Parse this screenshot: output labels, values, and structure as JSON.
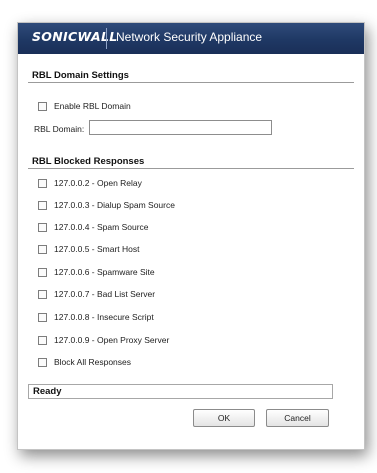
{
  "header": {
    "brand": "SONICWALL",
    "title": "Network Security Appliance"
  },
  "rbl_domain_settings": {
    "title": "RBL Domain Settings",
    "enable_label": "Enable RBL Domain",
    "domain_label": "RBL Domain:",
    "domain_value": ""
  },
  "rbl_blocked_responses": {
    "title": "RBL Blocked Responses",
    "items": [
      {
        "label": "127.0.0.2 - Open Relay"
      },
      {
        "label": "127.0.0.3 - Dialup Spam Source"
      },
      {
        "label": "127.0.0.4 - Spam Source"
      },
      {
        "label": "127.0.0.5 - Smart Host"
      },
      {
        "label": "127.0.0.6 - Spamware Site"
      },
      {
        "label": "127.0.0.7 - Bad List Server"
      },
      {
        "label": "127.0.0.8 - Insecure Script"
      },
      {
        "label": "127.0.0.9 - Open Proxy Server"
      },
      {
        "label": "Block All Responses"
      }
    ]
  },
  "status": {
    "text": "Ready"
  },
  "buttons": {
    "ok": "OK",
    "cancel": "Cancel"
  },
  "colors": {
    "header_bg": "#1f3864",
    "header_text": "#ffffff"
  }
}
